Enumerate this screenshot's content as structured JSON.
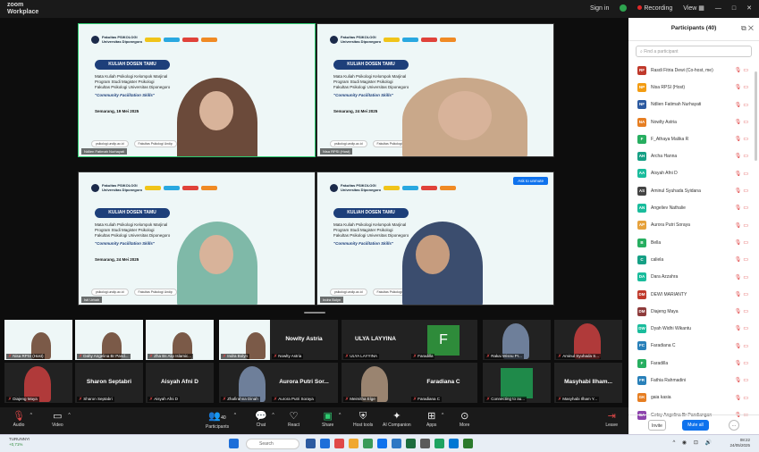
{
  "window": {
    "app_name_line1": "zoom",
    "app_name_line2": "Workplace",
    "sign_in": "Sign in",
    "recording": "Recording",
    "view": "View",
    "view_icon": "grid-icon",
    "controls": [
      "—",
      "□",
      "✕"
    ]
  },
  "slide": {
    "faculty_line1": "Fakultas PSIKOLOGI",
    "faculty_line2": "Universitas Diponegoro",
    "title": "KULIAH DOSEN TAMU",
    "body_lines": [
      "Mata Kuliah Psikologi Kelompok Marjinal",
      "Program Studi Magister Psikologi",
      "Fakultas Psikologi Universitas Diponegoro"
    ],
    "quote": "\"Community Facilitation Skills\"",
    "footer_web": "psikologi.undip.ac.id",
    "footer_social": "Fakultas Psikologi Undip"
  },
  "tiles": [
    {
      "name": "Ndlien Fatimah Nurhayati",
      "date": "Semarang, 19 Mei 2025",
      "color": "#6b4a3a"
    },
    {
      "name": "Nisa RPSI (Host)",
      "date": "Semarang, 24 Mei 2025",
      "color": "#c9a88a"
    },
    {
      "name": "Isti Urbah",
      "date": "Semarang, 24 Mei 2025",
      "color": "#7fb9a8"
    },
    {
      "name": "Indra Bolyn",
      "date": "",
      "color": "#3b4d6e"
    }
  ],
  "ask_to_unmute": "Ask to unmute",
  "strip_row1": [
    {
      "label": "Nisa RPSI (Host)",
      "kind": "slide"
    },
    {
      "label": "Dahy Angelina Br Pand...",
      "kind": "slide"
    },
    {
      "label": "Zha Bs Alip Islamic...",
      "kind": "slide"
    },
    {
      "label": "Indra Bolyn",
      "kind": "slide"
    },
    {
      "label": "Nowlty Astria",
      "kind": "name"
    },
    {
      "label": "ULYA LAYYINA",
      "kind": "name"
    },
    {
      "label": "Faradilla",
      "kind": "avatar",
      "letter": "F",
      "color": "#2e8b3a"
    },
    {
      "label": "Rakai Wisnu Pr...",
      "kind": "photo"
    },
    {
      "label": "Aminul Syuhada S...",
      "kind": "photo"
    }
  ],
  "strip_row2": [
    {
      "label": "Diajeng Maya",
      "kind": "photo"
    },
    {
      "label": "Sharon Septabri",
      "kind": "name"
    },
    {
      "label": "Aisyah Afni D",
      "kind": "name"
    },
    {
      "label": "Zhafirahna Dinah",
      "kind": "photo"
    },
    {
      "label": "Aurora Putri Soraya",
      "kind": "name",
      "title": "Aurora Putri Sor..."
    },
    {
      "label": "Meimitha Elge",
      "kind": "photo"
    },
    {
      "label": "Faradiana C",
      "kind": "name"
    },
    {
      "label": "Connecting to au...",
      "kind": "green"
    },
    {
      "label": "Masyhabi Ilham Y...",
      "kind": "name",
      "title": "Masyhabi Ilham..."
    }
  ],
  "toolbar": {
    "audio": "Audio",
    "video": "Video",
    "participants": "Participants",
    "participants_count": "40",
    "chat": "Chat",
    "react": "React",
    "share": "Share",
    "host_tools": "Host tools",
    "ai_companion": "AI Companion",
    "apps": "Apps",
    "more": "More",
    "leave": "Leave"
  },
  "panel": {
    "title": "Participants (40)",
    "search_placeholder": "Find a participant",
    "invite": "Invite",
    "mute_all": "Mute all",
    "more": "···",
    "participants": [
      {
        "initials": "RF",
        "name": "Rasdi Fitria Dewi (Co-host, me)",
        "color": "#c0392b"
      },
      {
        "initials": "NP",
        "name": "Nisa RPSI (Host)",
        "color": "#f39c12"
      },
      {
        "initials": "NF",
        "name": "Ndlien Fatimah Nurhayati",
        "color": "#2c5aa0"
      },
      {
        "initials": "NA",
        "name": "Nowlty Astria",
        "color": "#e67e22"
      },
      {
        "initials": "F",
        "name": "F_Athaya Malika R",
        "color": "#27ae60"
      },
      {
        "initials": "AH",
        "name": "Archa Hanna",
        "color": "#16a085"
      },
      {
        "initials": "AA",
        "name": "Aisyah Afni D",
        "color": "#1abc9c"
      },
      {
        "initials": "AS",
        "name": "Aminul Syuhada Syidana",
        "color": "#444444"
      },
      {
        "initials": "AN",
        "name": "Angeliev Nathalie",
        "color": "#1abc9c"
      },
      {
        "initials": "AP",
        "name": "Aurora Putri Soraya",
        "color": "#e6a23c"
      },
      {
        "initials": "B",
        "name": "Bella",
        "color": "#27ae60"
      },
      {
        "initials": "C",
        "name": "caliela",
        "color": "#16a085"
      },
      {
        "initials": "DA",
        "name": "Dara Azzahra",
        "color": "#1abc9c"
      },
      {
        "initials": "DM",
        "name": "DEWI MARIANTY",
        "color": "#c0392b"
      },
      {
        "initials": "DM",
        "name": "Diajeng Maya",
        "color": "#8e3b3b"
      },
      {
        "initials": "DW",
        "name": "Dyah Widhi Wikantu",
        "color": "#1abc9c"
      },
      {
        "initials": "FC",
        "name": "Faradiana C",
        "color": "#2980b9"
      },
      {
        "initials": "F",
        "name": "Faradilla",
        "color": "#27ae60"
      },
      {
        "initials": "FR",
        "name": "Fathia Rahmadini",
        "color": "#2980b9"
      },
      {
        "initials": "GK",
        "name": "gaia kasia",
        "color": "#e67e22"
      },
      {
        "initials": "GA",
        "name": "Getsy Angelina Br Pandiangan",
        "color": "#8e44ad"
      }
    ]
  },
  "taskbar": {
    "weather_line1": "TURUNNYI",
    "weather_line2": "+0,71%",
    "search": "Search",
    "time": "08:22",
    "date": "24/05/2025"
  }
}
